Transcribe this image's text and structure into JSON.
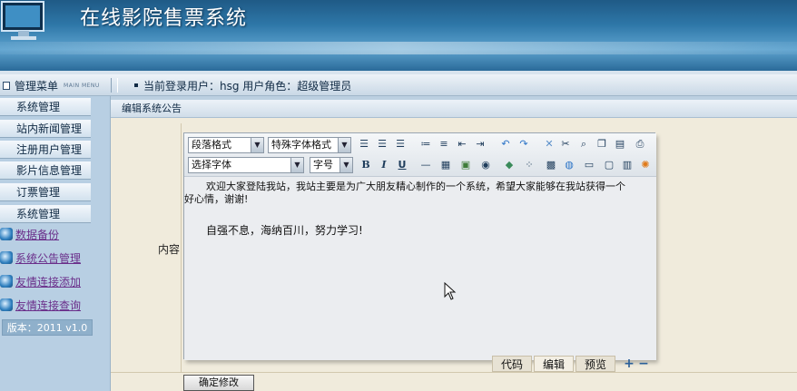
{
  "app": {
    "title": "在线影院售票系统"
  },
  "topbar": {
    "menu_title": "管理菜单",
    "menu_title_en": "MAIN MENU",
    "user_info": "当前登录用户：hsg  用户角色：超级管理员"
  },
  "sidebar": {
    "items": [
      {
        "label": "系统管理"
      },
      {
        "label": "站内新闻管理"
      },
      {
        "label": "注册用户管理"
      },
      {
        "label": "影片信息管理"
      },
      {
        "label": "订票管理"
      },
      {
        "label": "系统管理"
      }
    ],
    "sub_items": [
      {
        "label": "数据备份",
        "icon": "folder-icon"
      },
      {
        "label": "系统公告管理",
        "icon": "folder-icon"
      },
      {
        "label": "友情连接添加",
        "icon": "folder-icon"
      },
      {
        "label": "友情连接查询",
        "icon": "folder-icon"
      }
    ],
    "version": "版本：2011 v1.0"
  },
  "main": {
    "header": "编辑系统公告",
    "content_label": "内容",
    "editor": {
      "paragraph_format": "段落格式",
      "special_format": "特殊字体格式",
      "font_select": "选择字体",
      "size_select": "字号",
      "bold": "B",
      "italic": "I",
      "underline": "U",
      "paragraph1_line1": "欢迎大家登陆我站，我站主要是为广大朋友精心制作的一个系统，希望大家能够在我站获得一个",
      "paragraph1_line2": "好心情，谢谢!",
      "paragraph2": "自强不息，海纳百川，努力学习!"
    },
    "tabs": [
      {
        "label": "代码"
      },
      {
        "label": "编辑"
      },
      {
        "label": "预览"
      }
    ],
    "submit_label": "确定修改"
  },
  "colors": {
    "banner": "#2e77a8",
    "content_bg": "#f0ebdc",
    "link": "#6a2e8a"
  }
}
